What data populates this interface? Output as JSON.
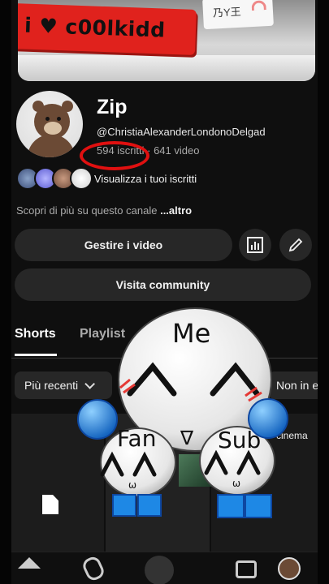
{
  "banner": {
    "sign_text": "i ♥ c00lkidd",
    "card_text": "乃Y王"
  },
  "channel": {
    "name": "Zip",
    "handle": "@ChristiaAlexanderLondonoDelgad",
    "stats": "594 iscritti · 641 video",
    "view_subscribers": "Visualizza i tuoi iscritti",
    "about_prefix": "Scopri di più su questo canale",
    "about_more": "...altro"
  },
  "buttons": {
    "manage": "Gestire i video",
    "community": "Visita community"
  },
  "icons": {
    "stats": "analytics-icon",
    "edit": "pencil-icon"
  },
  "tabs": [
    {
      "label": "Shorts"
    },
    {
      "label": "Playlist"
    }
  ],
  "chips": {
    "recent": "Più recenti",
    "other": "Non in e"
  },
  "grid": {
    "cell3_text": "cinema"
  },
  "sticker": {
    "top": "Me",
    "left": "Fan",
    "right": "Sub",
    "middle": "∇"
  },
  "colors": {
    "accent_red": "#e01010",
    "sticker_blue": "#1e88e5",
    "background": "#0f0f0f"
  }
}
